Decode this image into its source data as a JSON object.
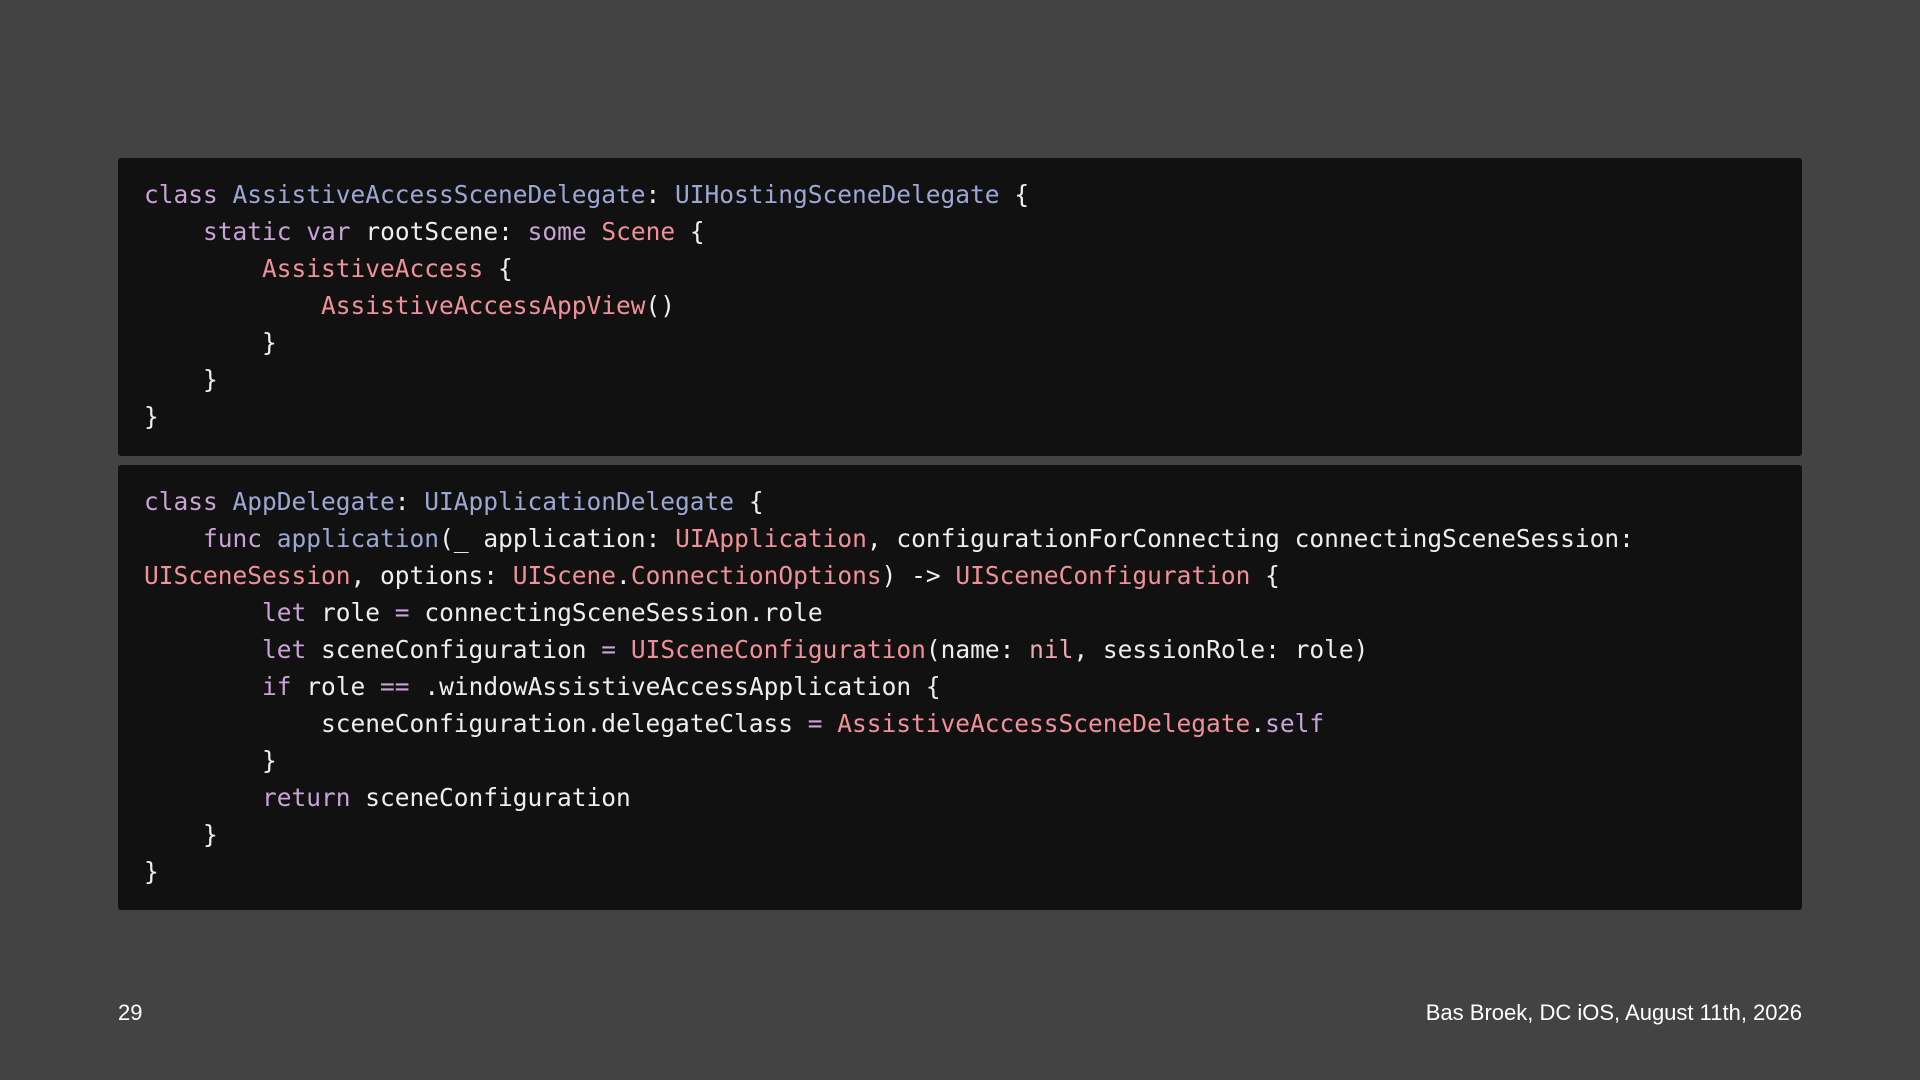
{
  "colors": {
    "background": "#434343",
    "code_background": "#111111",
    "plain": "#eeeeee",
    "keyword": "#c9a3d6",
    "type_name": "#9da7d4",
    "other_type": "#f0909a",
    "literal": "#f0a8b0"
  },
  "code_blocks": [
    {
      "lines": [
        [
          {
            "t": "class ",
            "k": "keyword"
          },
          {
            "t": "AssistiveAccessSceneDelegate",
            "k": "type_name"
          },
          {
            "t": ": ",
            "k": "plain"
          },
          {
            "t": "UIHostingSceneDelegate",
            "k": "type_name"
          },
          {
            "t": " {",
            "k": "plain"
          }
        ],
        [
          {
            "t": "    ",
            "k": "plain"
          },
          {
            "t": "static",
            "k": "keyword"
          },
          {
            "t": " ",
            "k": "plain"
          },
          {
            "t": "var",
            "k": "keyword"
          },
          {
            "t": " rootScene: ",
            "k": "plain"
          },
          {
            "t": "some",
            "k": "keyword"
          },
          {
            "t": " ",
            "k": "plain"
          },
          {
            "t": "Scene",
            "k": "other_type"
          },
          {
            "t": " {",
            "k": "plain"
          }
        ],
        [
          {
            "t": "        ",
            "k": "plain"
          },
          {
            "t": "AssistiveAccess",
            "k": "other_type"
          },
          {
            "t": " {",
            "k": "plain"
          }
        ],
        [
          {
            "t": "            ",
            "k": "plain"
          },
          {
            "t": "AssistiveAccessAppView",
            "k": "other_type"
          },
          {
            "t": "()",
            "k": "plain"
          }
        ],
        [
          {
            "t": "        }",
            "k": "plain"
          }
        ],
        [
          {
            "t": "    }",
            "k": "plain"
          }
        ],
        [
          {
            "t": "}",
            "k": "plain"
          }
        ]
      ]
    },
    {
      "lines": [
        [
          {
            "t": "class ",
            "k": "keyword"
          },
          {
            "t": "AppDelegate",
            "k": "type_name"
          },
          {
            "t": ": ",
            "k": "plain"
          },
          {
            "t": "UIApplicationDelegate",
            "k": "type_name"
          },
          {
            "t": " {",
            "k": "plain"
          }
        ],
        [
          {
            "t": "    ",
            "k": "plain"
          },
          {
            "t": "func",
            "k": "keyword"
          },
          {
            "t": " ",
            "k": "plain"
          },
          {
            "t": "application",
            "k": "type_name"
          },
          {
            "t": "(_ application: ",
            "k": "plain"
          },
          {
            "t": "UIApplication",
            "k": "other_type"
          },
          {
            "t": ", configurationForConnecting connectingSceneSession:",
            "k": "plain"
          }
        ],
        [
          {
            "t": "UISceneSession",
            "k": "other_type"
          },
          {
            "t": ", options: ",
            "k": "plain"
          },
          {
            "t": "UIScene",
            "k": "other_type"
          },
          {
            "t": ".",
            "k": "plain"
          },
          {
            "t": "ConnectionOptions",
            "k": "other_type"
          },
          {
            "t": ") -> ",
            "k": "plain"
          },
          {
            "t": "UISceneConfiguration",
            "k": "other_type"
          },
          {
            "t": " {",
            "k": "plain"
          }
        ],
        [
          {
            "t": "        ",
            "k": "plain"
          },
          {
            "t": "let",
            "k": "keyword"
          },
          {
            "t": " role ",
            "k": "plain"
          },
          {
            "t": "=",
            "k": "keyword"
          },
          {
            "t": " connectingSceneSession.role",
            "k": "plain"
          }
        ],
        [
          {
            "t": "        ",
            "k": "plain"
          },
          {
            "t": "let",
            "k": "keyword"
          },
          {
            "t": " sceneConfiguration ",
            "k": "plain"
          },
          {
            "t": "=",
            "k": "keyword"
          },
          {
            "t": " ",
            "k": "plain"
          },
          {
            "t": "UISceneConfiguration",
            "k": "other_type"
          },
          {
            "t": "(name: ",
            "k": "plain"
          },
          {
            "t": "nil",
            "k": "literal"
          },
          {
            "t": ", sessionRole: role)",
            "k": "plain"
          }
        ],
        [
          {
            "t": "        ",
            "k": "plain"
          },
          {
            "t": "if",
            "k": "keyword"
          },
          {
            "t": " role ",
            "k": "plain"
          },
          {
            "t": "==",
            "k": "keyword"
          },
          {
            "t": " .windowAssistiveAccessApplication {",
            "k": "plain"
          }
        ],
        [
          {
            "t": "            sceneConfiguration.delegateClass ",
            "k": "plain"
          },
          {
            "t": "=",
            "k": "keyword"
          },
          {
            "t": " ",
            "k": "plain"
          },
          {
            "t": "AssistiveAccessSceneDelegate",
            "k": "other_type"
          },
          {
            "t": ".",
            "k": "plain"
          },
          {
            "t": "self",
            "k": "keyword"
          }
        ],
        [
          {
            "t": "        }",
            "k": "plain"
          }
        ],
        [
          {
            "t": "        ",
            "k": "plain"
          },
          {
            "t": "return",
            "k": "keyword"
          },
          {
            "t": " sceneConfiguration",
            "k": "plain"
          }
        ],
        [
          {
            "t": "    }",
            "k": "plain"
          }
        ],
        [
          {
            "t": "}",
            "k": "plain"
          }
        ]
      ]
    }
  ],
  "footer": {
    "page_number": "29",
    "credit": "Bas Broek, DC iOS, August 11th, 2026"
  }
}
